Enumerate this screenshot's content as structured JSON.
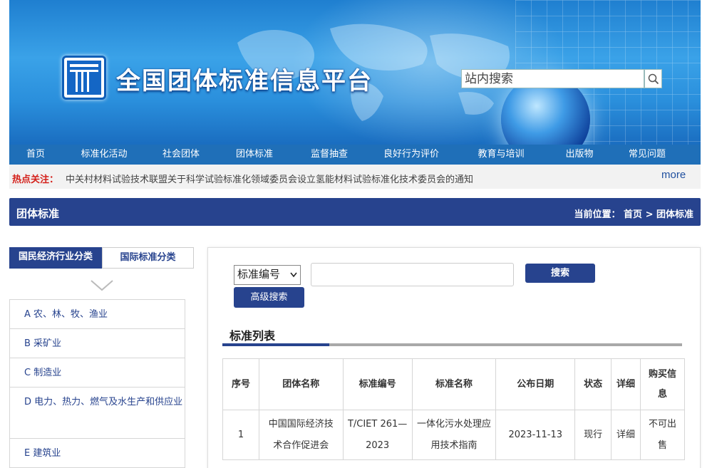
{
  "site": {
    "title": "全国团体标准信息平台",
    "search_placeholder": "站内搜索"
  },
  "nav": [
    {
      "label": "首页"
    },
    {
      "label": "标准化活动"
    },
    {
      "label": "社会团体"
    },
    {
      "label": "团体标准"
    },
    {
      "label": "监督抽查"
    },
    {
      "label": "良好行为评价"
    },
    {
      "label": "教育与培训"
    },
    {
      "label": "出版物"
    },
    {
      "label": "常见问题"
    }
  ],
  "hot": {
    "label": "热点关注：",
    "text": "中关村材料试验技术联盟关于科学试验标准化领域委员会设立氢能材料试验标准化技术委员会的通知",
    "more": "more"
  },
  "section": {
    "title": "团体标准",
    "breadcrumb": "当前位置：  首页 > 团体标准"
  },
  "sidebar": {
    "tabs": [
      {
        "label": "国民经济行业分类"
      },
      {
        "label": "国际标准分类"
      }
    ],
    "items": [
      {
        "label": "A 农、林、牧、渔业"
      },
      {
        "label": "B 采矿业"
      },
      {
        "label": "C 制造业"
      },
      {
        "label": "D 电力、热力、燃气及水生产和供应业"
      },
      {
        "label": "E 建筑业"
      }
    ]
  },
  "search": {
    "select_value": "标准编号",
    "search_button": "搜索",
    "advanced_button": "高级搜索"
  },
  "list": {
    "title": "标准列表",
    "headers": [
      "序号",
      "团体名称",
      "标准编号",
      "标准名称",
      "公布日期",
      "状态",
      "详细",
      "购买信息"
    ],
    "rows": [
      {
        "index": "1",
        "org": "中国国际经济技术合作促进会",
        "code": "T/CIET 261—2023",
        "name": "一体化污水处理应用技术指南",
        "date": "2023-11-13",
        "status": "现行",
        "detail": "详细",
        "buy": "不可出售"
      }
    ]
  },
  "colors": {
    "primary": "#27438e",
    "nav": "#1f6fb8",
    "hot_label": "#d4201a"
  }
}
